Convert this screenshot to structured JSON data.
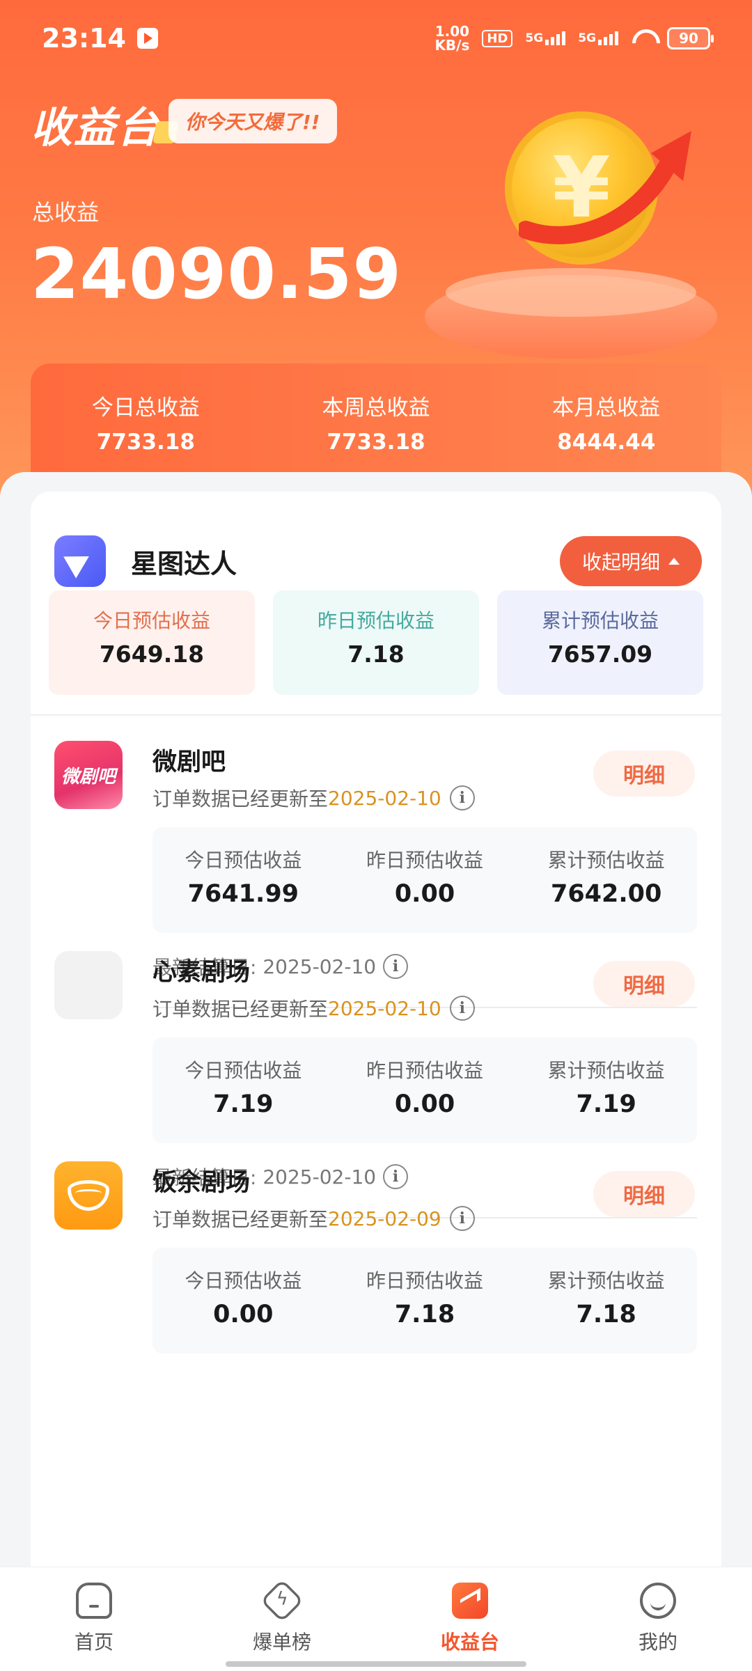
{
  "status_bar": {
    "time": "23:14",
    "net_speed_value": "1.00",
    "net_speed_unit": "KB/s",
    "hd": "HD",
    "sim1": "5G",
    "sim2": "5G",
    "battery": "90"
  },
  "header": {
    "title": "收益台",
    "badge": "你今天又爆了!!",
    "total_label": "总收益",
    "total_value": "24090.59",
    "coin_symbol": "¥",
    "summary": [
      {
        "label": "今日总收益",
        "value": "7733.18"
      },
      {
        "label": "本周总收益",
        "value": "7733.18"
      },
      {
        "label": "本月总收益",
        "value": "8444.44"
      }
    ]
  },
  "platform": {
    "name": "星图达人",
    "collapse_label": "收起明细",
    "stats": [
      {
        "label": "今日预估收益",
        "value": "7649.18"
      },
      {
        "label": "昨日预估收益",
        "value": "7.18"
      },
      {
        "label": "累计预估收益",
        "value": "7657.09"
      }
    ]
  },
  "apps": [
    {
      "name": "微剧吧",
      "icon_text": "微剧吧",
      "update_prefix": "订单数据已经更新至",
      "update_date": "2025-02-10",
      "detail_label": "明细",
      "stats": [
        {
          "label": "今日预估收益",
          "value": "7641.99"
        },
        {
          "label": "昨日预估收益",
          "value": "0.00"
        },
        {
          "label": "累计预估收益",
          "value": "7642.00"
        }
      ],
      "settle_label": "最新结算日:",
      "settle_date": "2025-02-10"
    },
    {
      "name": "心素剧场",
      "update_prefix": "订单数据已经更新至",
      "update_date": "2025-02-10",
      "detail_label": "明细",
      "stats": [
        {
          "label": "今日预估收益",
          "value": "7.19"
        },
        {
          "label": "昨日预估收益",
          "value": "0.00"
        },
        {
          "label": "累计预估收益",
          "value": "7.19"
        }
      ],
      "settle_label": "最新结算日:",
      "settle_date": "2025-02-10"
    },
    {
      "name": "饭余剧场",
      "update_prefix": "订单数据已经更新至",
      "update_date": "2025-02-09",
      "detail_label": "明细",
      "stats": [
        {
          "label": "今日预估收益",
          "value": "0.00"
        },
        {
          "label": "昨日预估收益",
          "value": "7.18"
        },
        {
          "label": "累计预估收益",
          "value": "7.18"
        }
      ]
    }
  ],
  "bottom_nav": [
    {
      "label": "首页",
      "icon": "home-icon"
    },
    {
      "label": "爆单榜",
      "icon": "bolt-icon"
    },
    {
      "label": "收益台",
      "icon": "earnings-icon",
      "active": true
    },
    {
      "label": "我的",
      "icon": "profile-icon"
    }
  ],
  "colors": {
    "accent": "#f2562e",
    "date_highlight": "#d99220"
  }
}
